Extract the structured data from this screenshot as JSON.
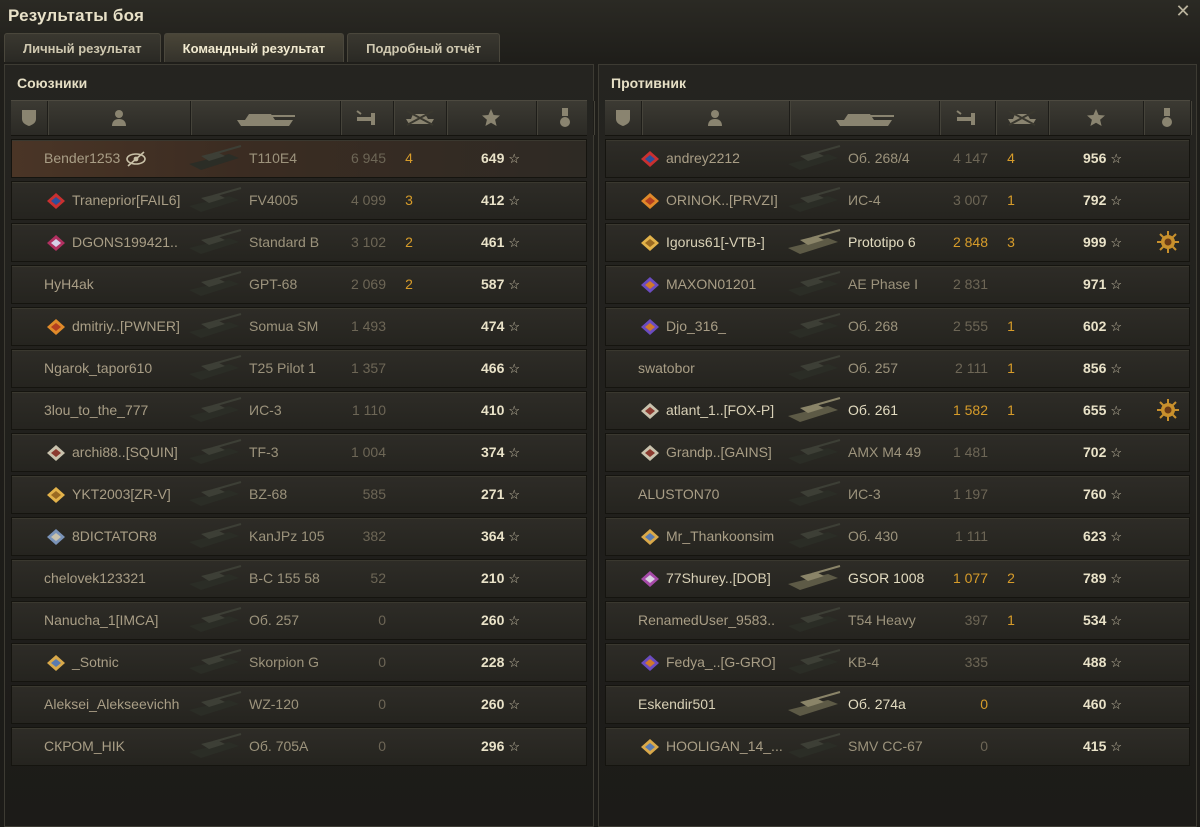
{
  "window": {
    "title": "Результаты боя"
  },
  "tabs": [
    {
      "label": "Личный результат",
      "active": false
    },
    {
      "label": "Командный результат",
      "active": true
    },
    {
      "label": "Подробный отчёт",
      "active": false
    }
  ],
  "header_icons": [
    "clan-icon",
    "player-icon",
    "tank-icon",
    "damage-icon",
    "kills-icon",
    "xp-star-icon",
    "medal-icon"
  ],
  "colors": {
    "accent_orange": "#d79c2a",
    "row_highlight": "#4a3526",
    "text_light": "#e9e2c8"
  },
  "allies": {
    "title": "Союзники",
    "rows": [
      {
        "name": "Bender1253",
        "badge": "eye-slash-icon",
        "vehicle": "T110E4",
        "damage": "6 945",
        "kills": "4",
        "xp": "649",
        "highlight": true
      },
      {
        "name": "Traneprior[FAIL6]",
        "badge": "clan-emblem-red",
        "vehicle": "FV4005",
        "damage": "4 099",
        "kills": "3",
        "xp": "412"
      },
      {
        "name": "DGONS199421..",
        "badge": "clan-emblem-shield",
        "vehicle": "Standard B",
        "damage": "3 102",
        "kills": "2",
        "xp": "461"
      },
      {
        "name": "HyH4ak",
        "badge": "",
        "vehicle": "GPT-68",
        "damage": "2 069",
        "kills": "2",
        "xp": "587"
      },
      {
        "name": "dmitriy..[PWNER]",
        "badge": "clan-emblem-orange",
        "vehicle": "Somua SM",
        "damage": "1 493",
        "kills": "",
        "xp": "474"
      },
      {
        "name": "Ngarok_tapor610",
        "badge": "",
        "vehicle": "T25 Pilot 1",
        "damage": "1 357",
        "kills": "",
        "xp": "466"
      },
      {
        "name": "3lou_to_the_777",
        "badge": "",
        "vehicle": "ИС-3",
        "damage": "1 110",
        "kills": "",
        "xp": "410"
      },
      {
        "name": "archi88..[SQUIN]",
        "badge": "clan-emblem-diamond",
        "vehicle": "TF-3",
        "damage": "1 004",
        "kills": "",
        "xp": "374"
      },
      {
        "name": "YKT2003[ZR-V]",
        "badge": "clan-emblem-gold",
        "vehicle": "BZ-68",
        "damage": "585",
        "kills": "",
        "xp": "271"
      },
      {
        "name": "8DICTATOR8",
        "badge": "clan-emblem-swords",
        "vehicle": "KanJPz 105",
        "damage": "382",
        "kills": "",
        "xp": "364"
      },
      {
        "name": "chelovek123321",
        "badge": "",
        "vehicle": "B-C 155 58",
        "damage": "52",
        "kills": "",
        "xp": "210"
      },
      {
        "name": "Nanucha_1[IMCA]",
        "badge": "",
        "vehicle": "Об. 257",
        "damage": "0",
        "kills": "",
        "xp": "260"
      },
      {
        "name": "_Sotnic",
        "badge": "clan-emblem-cog",
        "vehicle": "Skorpion G",
        "damage": "0",
        "kills": "",
        "xp": "228"
      },
      {
        "name": "Aleksei_Alekseevichh",
        "badge": "",
        "vehicle": "WZ-120",
        "damage": "0",
        "kills": "",
        "xp": "260"
      },
      {
        "name": "СКРОМ_НIK",
        "badge": "",
        "vehicle": "Об. 705А",
        "damage": "0",
        "kills": "",
        "xp": "296"
      }
    ]
  },
  "enemies": {
    "title": "Противник",
    "rows": [
      {
        "name": "andrey2212",
        "badge": "clan-emblem-red",
        "vehicle": "Об. 268/4",
        "damage": "4 147",
        "kills": "4",
        "xp": "956"
      },
      {
        "name": "ORINOK..[PRVZI]",
        "badge": "clan-emblem-orange",
        "vehicle": "ИС-4",
        "damage": "3 007",
        "kills": "1",
        "xp": "792"
      },
      {
        "name": "Igorus61[-VTB-]",
        "badge": "clan-emblem-gold",
        "vehicle": "Prototipo 6",
        "damage": "2 848",
        "kills": "3",
        "xp": "999",
        "bright": true,
        "medal": true
      },
      {
        "name": "MAXON01201",
        "badge": "clan-emblem-purple",
        "vehicle": "AE Phase I",
        "damage": "2 831",
        "kills": "",
        "xp": "971"
      },
      {
        "name": "Djo_316_",
        "badge": "clan-emblem-purple",
        "vehicle": "Об. 268",
        "damage": "2 555",
        "kills": "1",
        "xp": "602"
      },
      {
        "name": "swatobor",
        "badge": "",
        "vehicle": "Об. 257",
        "damage": "2 111",
        "kills": "1",
        "xp": "856"
      },
      {
        "name": "atlant_1..[FOX-P]",
        "badge": "clan-emblem-diamond",
        "vehicle": "Об. 261",
        "damage": "1 582",
        "kills": "1",
        "xp": "655",
        "bright": true,
        "medal": true
      },
      {
        "name": "Grandp..[GAINS]",
        "badge": "clan-emblem-diamond",
        "vehicle": "AMX M4 49",
        "damage": "1 481",
        "kills": "",
        "xp": "702"
      },
      {
        "name": "ALUSTON70",
        "badge": "",
        "vehicle": "ИС-3",
        "damage": "1 197",
        "kills": "",
        "xp": "760"
      },
      {
        "name": "Mr_Thankoonsim",
        "badge": "clan-emblem-cog",
        "vehicle": "Об. 430",
        "damage": "1 111",
        "kills": "",
        "xp": "623"
      },
      {
        "name": "77Shurey..[DOB]",
        "badge": "clan-emblem-swirl",
        "vehicle": "GSOR 1008",
        "damage": "1 077",
        "kills": "2",
        "xp": "789",
        "bright": true
      },
      {
        "name": "RenamedUser_9583..",
        "badge": "",
        "vehicle": "T54 Heavy",
        "damage": "397",
        "kills": "1",
        "xp": "534"
      },
      {
        "name": "Fedya_..[G-GRO]",
        "badge": "clan-emblem-purple",
        "vehicle": "KB-4",
        "damage": "335",
        "kills": "",
        "xp": "488"
      },
      {
        "name": "Eskendir501",
        "badge": "",
        "vehicle": "Об. 274а",
        "damage": "0",
        "kills": "",
        "xp": "460",
        "bright": true
      },
      {
        "name": "HOOLIGAN_14_...",
        "badge": "clan-emblem-cog",
        "vehicle": "SMV CC-67",
        "damage": "0",
        "kills": "",
        "xp": "415"
      }
    ]
  }
}
